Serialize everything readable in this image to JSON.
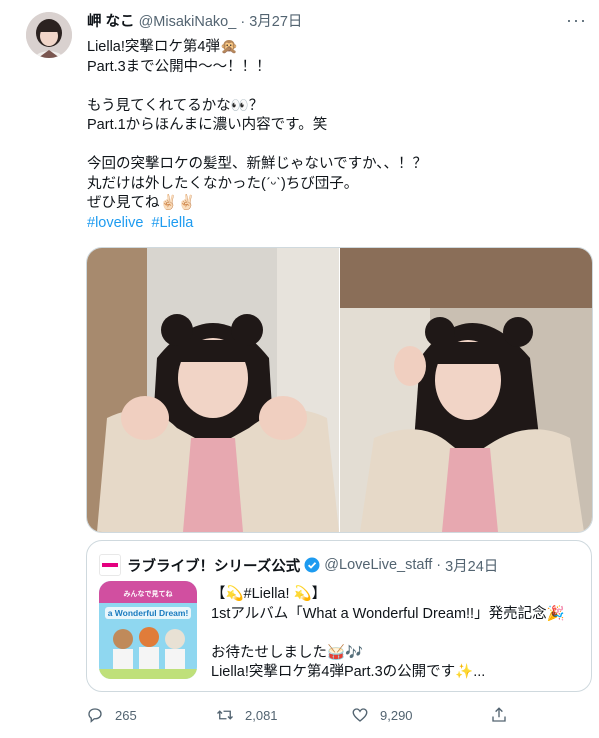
{
  "tweet": {
    "display_name": "岬 なこ",
    "handle": "@MisakiNako_",
    "separator": "·",
    "date": "3月27日",
    "more": "···",
    "lines": [
      "Liella!突撃ロケ第4弾🙊",
      "Part.3まで公開中〜〜！！！",
      "",
      "もう見てくれてるかな👀？",
      "Part.1からほんまに濃い内容です。笑",
      "",
      "今回の突撃ロケの髪型、新鮮じゃないですか、、！？",
      "丸だけは外したくなかった(ˊᵕˋ)ちび団子。",
      "ぜひ見てね✌🏻✌🏻"
    ],
    "hashtags": [
      "#lovelive",
      "#Liella"
    ]
  },
  "quote": {
    "name": "ラブライブ！シリーズ公式",
    "handle": "@LoveLive_staff",
    "separator": "·",
    "date": "3月24日",
    "thumb_text": "a Wonderful Dream!",
    "thumb_sub": "みんなで見てね",
    "lines": [
      "【💫#Liella! 💫】",
      "1stアルバム「What a Wonderful Dream!!」発売記念🎉",
      "",
      "お待たせしました🥁🎶",
      "Liella!突撃ロケ第4弾Part.3の公開です✨..."
    ]
  },
  "actions": {
    "replies": "265",
    "retweets": "2,081",
    "likes": "9,290"
  },
  "colors": {
    "link": "#1d9bf0",
    "secondary_text": "#536471",
    "border": "#cfd9de",
    "verified": "#1d9bf0"
  }
}
